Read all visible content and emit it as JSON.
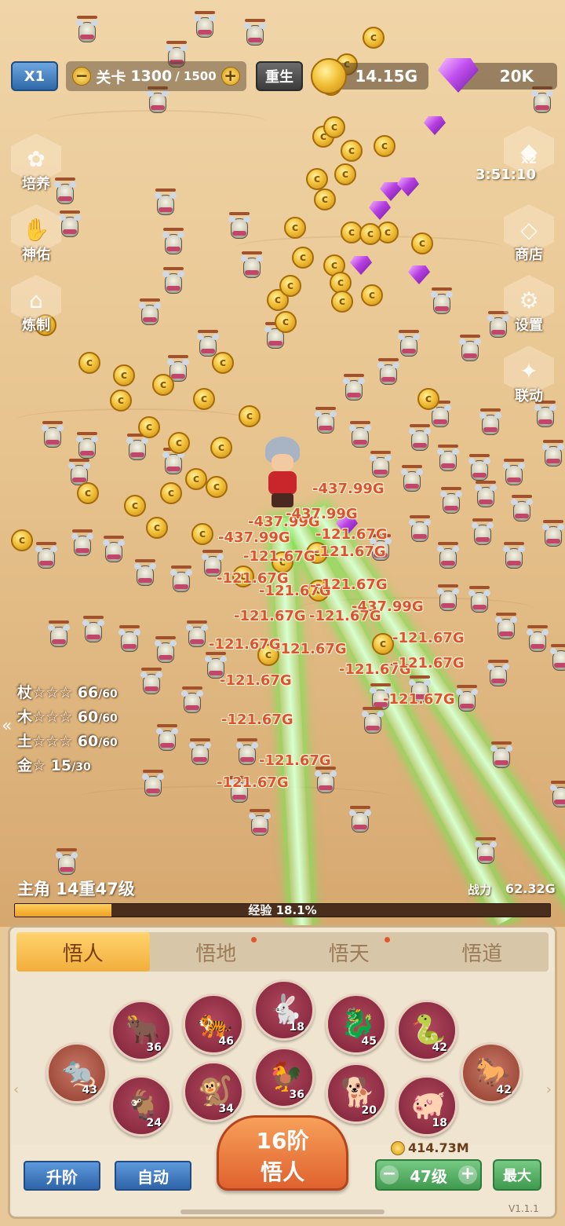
{
  "top_bar": {
    "speed_label": "X1",
    "stage_prefix": "关卡",
    "stage_current": "1300",
    "stage_total": "/ 1500",
    "minus_icon": "−",
    "plus_icon": "+",
    "rebirth_label": "重生",
    "gold_amount": "14.15G",
    "gem_amount": "20K"
  },
  "side_left": [
    {
      "name": "training",
      "label": "培养",
      "icon": "✿"
    },
    {
      "name": "blessing",
      "label": "神佑",
      "icon": "✋"
    },
    {
      "name": "forge",
      "label": "炼制",
      "icon": "⌂"
    }
  ],
  "side_right": [
    {
      "name": "double",
      "label": "",
      "icon": "◆"
    },
    {
      "name": "shop",
      "label": "商店",
      "icon": "◇"
    },
    {
      "name": "settings",
      "label": "设置",
      "icon": "⚙"
    },
    {
      "name": "collab",
      "label": "联动",
      "icon": "✦"
    }
  ],
  "double_badge": "x2",
  "double_timer": "3:51:10",
  "elements": [
    {
      "name": "杖☆☆☆",
      "value": "66",
      "max": "/60"
    },
    {
      "name": "木☆☆☆",
      "value": "60",
      "max": "/60"
    },
    {
      "name": "土☆☆☆",
      "value": "60",
      "max": "/60"
    },
    {
      "name": "金☆",
      "value": "15",
      "max": "/30"
    }
  ],
  "damage_numbers": [
    "-437.99G",
    "-437.99G",
    "-437.99G",
    "-437.99G",
    "-437.99G",
    "-121.67G",
    "-121.67G",
    "-121.67G",
    "-121.67G",
    "-121.67G",
    "-121.67G",
    "-121.67G",
    "-121.67G",
    "-121.67G",
    "-121.67G",
    "-121.67G",
    "-121.67G",
    "-121.67G"
  ],
  "coin_symbol": "c",
  "hero": {
    "level_label": "主角 14重47级",
    "power_label": "战力",
    "power_value": "62.32G",
    "exp_label": "经验 18.1%",
    "exp_progress": 0.181
  },
  "tabs": [
    {
      "label": "悟人",
      "active": true,
      "dot": false
    },
    {
      "label": "悟地",
      "active": false,
      "dot": true
    },
    {
      "label": "悟天",
      "active": false,
      "dot": true
    },
    {
      "label": "悟道",
      "active": false,
      "dot": false
    }
  ],
  "zodiac": [
    {
      "animal": "rat",
      "glyph": "🐀",
      "level": "43"
    },
    {
      "animal": "ox",
      "glyph": "🐂",
      "level": "36"
    },
    {
      "animal": "goat",
      "glyph": "🐐",
      "level": "24"
    },
    {
      "animal": "tiger",
      "glyph": "🐅",
      "level": "46"
    },
    {
      "animal": "monkey",
      "glyph": "🐒",
      "level": "34"
    },
    {
      "animal": "rabbit",
      "glyph": "🐇",
      "level": "18"
    },
    {
      "animal": "rooster",
      "glyph": "🐓",
      "level": "36"
    },
    {
      "animal": "dragon",
      "glyph": "🐉",
      "level": "45"
    },
    {
      "animal": "dog",
      "glyph": "🐕",
      "level": "20"
    },
    {
      "animal": "snake",
      "glyph": "🐍",
      "level": "42"
    },
    {
      "animal": "pig",
      "glyph": "🐖",
      "level": "18"
    },
    {
      "animal": "horse",
      "glyph": "🐎",
      "level": "42"
    }
  ],
  "actions": {
    "upgrade_label": "升阶",
    "auto_label": "自动",
    "stage_line1": "16阶",
    "stage_line2": "悟人",
    "cost": "414.73M",
    "level_value": "47级",
    "max_label": "最大"
  },
  "version": "V1.1.1",
  "colors": {
    "accent": "#f2ae3c",
    "button_blue": "#2f64a8",
    "button_green": "#3f9a4e",
    "damage": "#d9552f"
  }
}
